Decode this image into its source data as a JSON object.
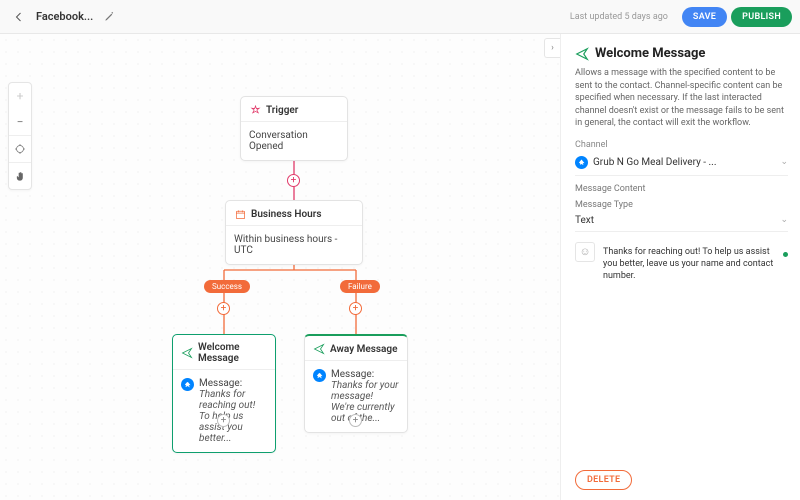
{
  "header": {
    "workflow_name": "Facebook...",
    "last_updated": "Last updated 5 days ago",
    "save_label": "SAVE",
    "publish_label": "PUBLISH"
  },
  "toolbar": {
    "zoom_in": "+",
    "zoom_out": "−",
    "fit": "⌖",
    "pan": "✋"
  },
  "nodes": {
    "trigger": {
      "title": "Trigger",
      "body": "Conversation Opened"
    },
    "hours": {
      "title": "Business Hours",
      "body": "Within business hours - UTC"
    },
    "welcome": {
      "title": "Welcome Message",
      "line1": "Message:",
      "line2": "Thanks for reaching out! To help us assist you better..."
    },
    "away": {
      "title": "Away Message",
      "line1": "Message:",
      "line2": "Thanks for your message! We're currently out of the..."
    }
  },
  "badges": {
    "success": "Success",
    "failure": "Failure"
  },
  "panel": {
    "title": "Welcome Message",
    "description": "Allows a message with the specified content to be sent to the contact. Channel-specific content can be specified when necessary. If the last interacted channel doesn't exist or the message fails to be sent in general, the contact will exit the workflow.",
    "channel_label": "Channel",
    "channel_value": "Grub N Go Meal Delivery - ...",
    "content_label": "Message Content",
    "type_label": "Message Type",
    "type_value": "Text",
    "message_text": "Thanks for reaching out! To help us assist you better, leave us your name and contact number.",
    "delete_label": "DELETE"
  },
  "colors": {
    "accent_green": "#1a9e5c",
    "accent_orange": "#f26b3a",
    "accent_pink": "#e13a6a",
    "save_blue": "#4285f4"
  }
}
